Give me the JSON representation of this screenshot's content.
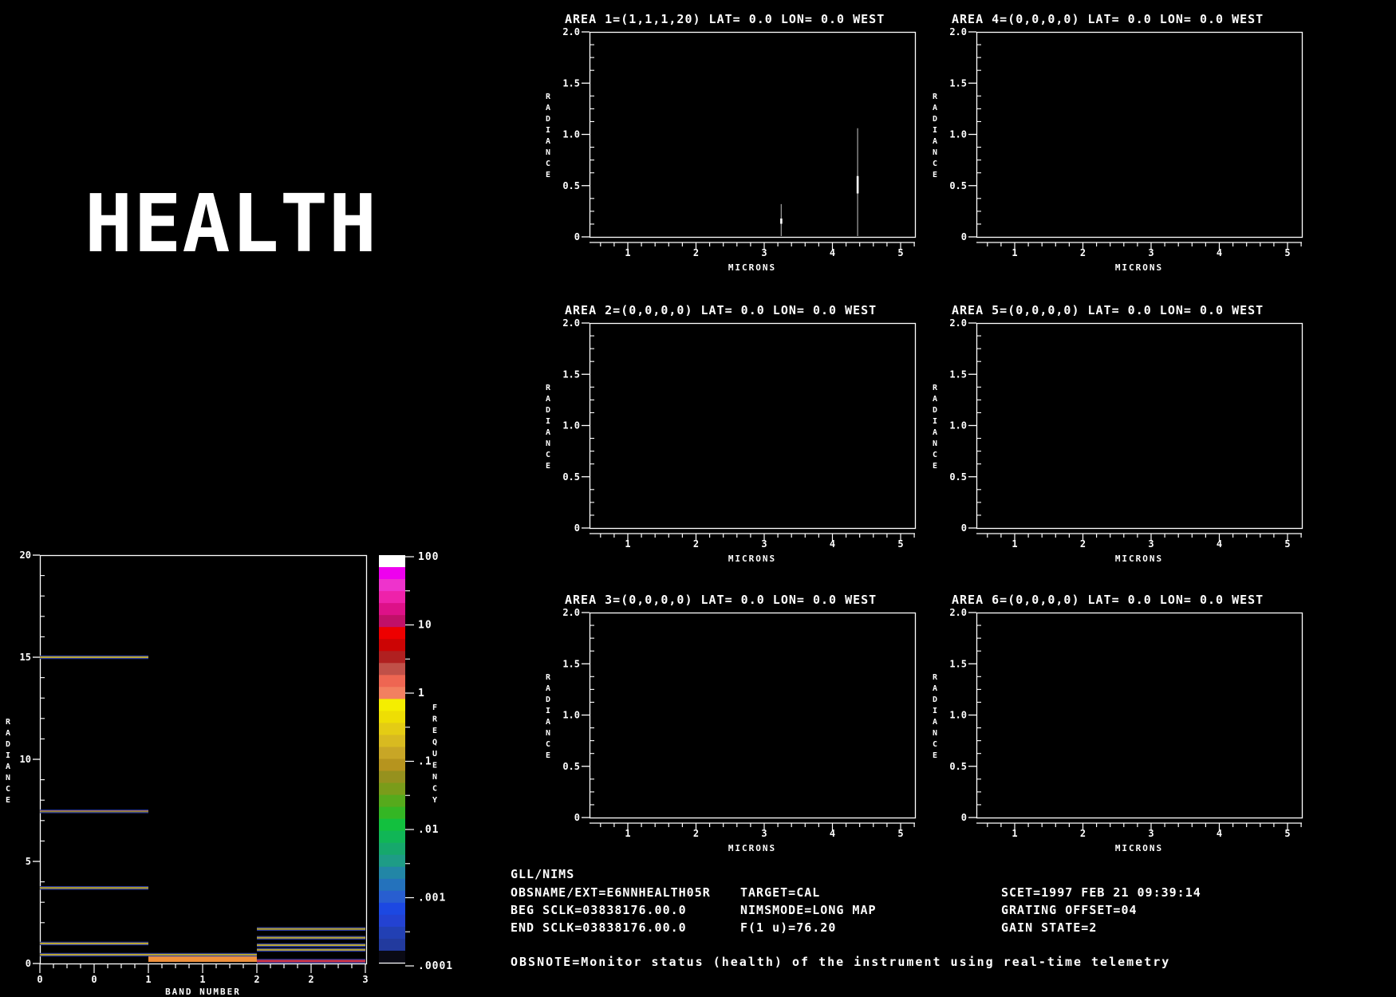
{
  "title_text": "HEALTH",
  "footer": {
    "line1": "GLL/NIMS",
    "col1": [
      "OBSNAME/EXT=E6NNHEALTH05R",
      "BEG SCLK=03838176.00.0",
      "END SCLK=03838176.00.0"
    ],
    "col2": [
      "TARGET=CAL",
      "NIMSMODE=LONG MAP",
      "F(1 u)=76.20"
    ],
    "col3": [
      "SCET=1997 FEB 21 09:39:14",
      "GRATING OFFSET=04",
      "GAIN STATE=2"
    ],
    "obsnote": "OBSNOTE=Monitor status (health) of the instrument using real-time telemetry"
  },
  "colorbar": {
    "ylabel": "FREQUENCY",
    "tick_labels": [
      "100",
      "10",
      "1",
      ".1",
      ".01",
      ".001",
      ".0001"
    ],
    "colors": [
      "#ffffff",
      "#ee00ee",
      "#ee33cc",
      "#ee22aa",
      "#dd1188",
      "#c01068",
      "#ee0000",
      "#cc0404",
      "#b02020",
      "#c05048",
      "#ee6652",
      "#f28060",
      "#f4ee00",
      "#eede04",
      "#e4cc14",
      "#d8ba20",
      "#c8a626",
      "#b6941e",
      "#96911e",
      "#7a9c1a",
      "#56aa1c",
      "#34b624",
      "#12c03e",
      "#10b656",
      "#16a86c",
      "#1e9c86",
      "#2286a6",
      "#2472bc",
      "#285ed0",
      "#1c48e2",
      "#2342d2",
      "#2240b4",
      "#223a9e",
      "#0a0a14"
    ]
  },
  "chart_data": [
    {
      "id": "area-1",
      "type": "line",
      "title": "AREA 1=(1,1,1,20) LAT=    0.0 LON=    0.0 WEST",
      "xlabel": "MICRONS",
      "ylabel": "RADIANCE",
      "xlim": [
        0.44,
        5.21
      ],
      "ylim": [
        0,
        2
      ],
      "x_ticks": [
        1,
        2,
        3,
        4,
        5
      ],
      "x_tick_labels": [
        "1",
        "2",
        "3",
        "4",
        "5"
      ],
      "y_ticks": [
        0,
        0.5,
        1,
        1.5,
        2
      ],
      "y_tick_labels": [
        "0",
        "0.5",
        "1.0",
        "1.5",
        "2.0"
      ],
      "series": [
        {
          "name": "spectral-lines",
          "style": "impulses",
          "points": [
            [
              3.25,
              0.32
            ],
            [
              4.37,
              1.06
            ]
          ]
        }
      ]
    },
    {
      "id": "area-2",
      "type": "line",
      "title": "AREA 2=(0,0,0,0) LAT=    0.0 LON=    0.0 WEST",
      "xlabel": "MICRONS",
      "ylabel": "RADIANCE",
      "xlim": [
        0.44,
        5.21
      ],
      "ylim": [
        0,
        2
      ],
      "x_ticks": [
        1,
        2,
        3,
        4,
        5
      ],
      "x_tick_labels": [
        "1",
        "2",
        "3",
        "4",
        "5"
      ],
      "y_ticks": [
        0,
        0.5,
        1,
        1.5,
        2
      ],
      "y_tick_labels": [
        "0",
        "0.5",
        "1.0",
        "1.5",
        "2.0"
      ],
      "series": [
        {
          "name": "spectral-lines",
          "style": "impulses",
          "points": []
        }
      ]
    },
    {
      "id": "area-3",
      "type": "line",
      "title": "AREA 3=(0,0,0,0) LAT=    0.0 LON=    0.0 WEST",
      "xlabel": "MICRONS",
      "ylabel": "RADIANCE",
      "xlim": [
        0.44,
        5.21
      ],
      "ylim": [
        0,
        2
      ],
      "x_ticks": [
        1,
        2,
        3,
        4,
        5
      ],
      "x_tick_labels": [
        "1",
        "2",
        "3",
        "4",
        "5"
      ],
      "y_ticks": [
        0,
        0.5,
        1,
        1.5,
        2
      ],
      "y_tick_labels": [
        "0",
        "0.5",
        "1.0",
        "1.5",
        "2.0"
      ],
      "series": [
        {
          "name": "spectral-lines",
          "style": "impulses",
          "points": []
        }
      ]
    },
    {
      "id": "area-4",
      "type": "line",
      "title": "AREA 4=(0,0,0,0) LAT=    0.0 LON=    0.0 WEST",
      "xlabel": "MICRONS",
      "ylabel": "RADIANCE",
      "xlim": [
        0.44,
        5.21
      ],
      "ylim": [
        0,
        2
      ],
      "x_ticks": [
        1,
        2,
        3,
        4,
        5
      ],
      "x_tick_labels": [
        "1",
        "2",
        "3",
        "4",
        "5"
      ],
      "y_ticks": [
        0,
        0.5,
        1,
        1.5,
        2
      ],
      "y_tick_labels": [
        "0",
        "0.5",
        "1.0",
        "1.5",
        "2.0"
      ],
      "series": [
        {
          "name": "spectral-lines",
          "style": "impulses",
          "points": []
        }
      ]
    },
    {
      "id": "area-5",
      "type": "line",
      "title": "AREA 5=(0,0,0,0) LAT=    0.0 LON=    0.0 WEST",
      "xlabel": "MICRONS",
      "ylabel": "RADIANCE",
      "xlim": [
        0.44,
        5.21
      ],
      "ylim": [
        0,
        2
      ],
      "x_ticks": [
        1,
        2,
        3,
        4,
        5
      ],
      "x_tick_labels": [
        "1",
        "2",
        "3",
        "4",
        "5"
      ],
      "y_ticks": [
        0,
        0.5,
        1,
        1.5,
        2
      ],
      "y_tick_labels": [
        "0",
        "0.5",
        "1.0",
        "1.5",
        "2.0"
      ],
      "series": [
        {
          "name": "spectral-lines",
          "style": "impulses",
          "points": []
        }
      ]
    },
    {
      "id": "area-6",
      "type": "line",
      "title": "AREA 6=(0,0,0,0) LAT=    0.0 LON=    0.0 WEST",
      "xlabel": "MICRONS",
      "ylabel": "RADIANCE",
      "xlim": [
        0.44,
        5.21
      ],
      "ylim": [
        0,
        2
      ],
      "x_ticks": [
        1,
        2,
        3,
        4,
        5
      ],
      "x_tick_labels": [
        "1",
        "2",
        "3",
        "4",
        "5"
      ],
      "y_ticks": [
        0,
        0.5,
        1,
        1.5,
        2
      ],
      "y_tick_labels": [
        "0",
        "0.5",
        "1.0",
        "1.5",
        "2.0"
      ],
      "series": [
        {
          "name": "spectral-lines",
          "style": "impulses",
          "points": []
        }
      ]
    },
    {
      "id": "band-histogram",
      "type": "heatmap",
      "title": "",
      "xlabel": "BAND NUMBER",
      "ylabel": "RADIANCE",
      "xlim": [
        0,
        3
      ],
      "ylim": [
        0,
        20
      ],
      "x_tick_labels": [
        "0",
        "0",
        "1",
        "1",
        "2",
        "2",
        "3"
      ],
      "y_ticks": [
        0,
        5,
        10,
        15,
        20
      ],
      "y_tick_labels": [
        "0",
        "5",
        "10",
        "15",
        "20"
      ],
      "lines": [
        {
          "band": [
            0,
            1
          ],
          "radiance": 15.0,
          "color": "#b8a432"
        },
        {
          "band": [
            0,
            1
          ],
          "radiance": 7.45,
          "color": "#c8825c",
          "color2": "#96963c"
        },
        {
          "band": [
            0,
            1
          ],
          "radiance": 3.7,
          "color": "#b8a432"
        },
        {
          "band": [
            0,
            1
          ],
          "radiance": 0.98,
          "color": "#b8a432"
        },
        {
          "band": [
            0,
            2
          ],
          "radiance": 0.43,
          "color": "#b8a432"
        },
        {
          "band": [
            2,
            3
          ],
          "radiance": 1.69,
          "color": "#b8a432"
        },
        {
          "band": [
            2,
            3
          ],
          "radiance": 1.26,
          "color": "#b8a432"
        },
        {
          "band": [
            2,
            3
          ],
          "radiance": 0.9,
          "color": "#b8a432"
        },
        {
          "band": [
            2,
            3
          ],
          "radiance": 0.67,
          "color": "#b8a432"
        },
        {
          "band": [
            2,
            3
          ],
          "radiance": 0.12,
          "color": "#cc3344",
          "thick": 3
        }
      ],
      "bar": {
        "band": [
          1,
          2
        ],
        "radiance": [
          0.08,
          0.39
        ],
        "color": "#f0913c"
      }
    }
  ]
}
